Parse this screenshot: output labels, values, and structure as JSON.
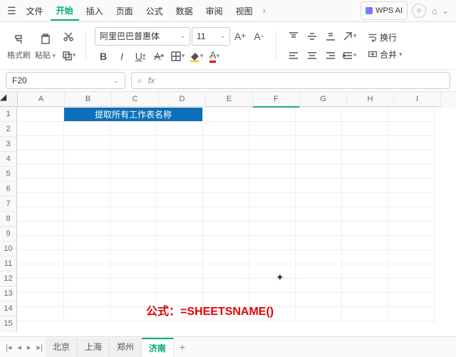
{
  "menu": {
    "file": "文件",
    "tabs": [
      "开始",
      "插入",
      "页面",
      "公式",
      "数据",
      "审阅",
      "视图"
    ],
    "activeIndex": 0,
    "ai": "WPS AI"
  },
  "toolbar": {
    "formatPainter": "格式刷",
    "paste": "粘贴",
    "fontName": "阿里巴巴普惠体",
    "fontSize": "11",
    "wrap": "换行",
    "merge": "合并"
  },
  "namebox": {
    "value": "F20"
  },
  "columns": [
    "A",
    "B",
    "C",
    "D",
    "E",
    "F",
    "G",
    "H",
    "I"
  ],
  "rows": [
    "1",
    "2",
    "3",
    "4",
    "5",
    "6",
    "7",
    "8",
    "9",
    "10",
    "11",
    "12",
    "13",
    "14",
    "15"
  ],
  "selectedCol": "F",
  "blueCell": {
    "text": "提取所有工作表名称"
  },
  "formulaOverlay": "公式：=SHEETSNAME()",
  "sheetTabs": [
    "北京",
    "上海",
    "郑州",
    "济南"
  ],
  "activeSheetIndex": 3,
  "chart_data": null
}
